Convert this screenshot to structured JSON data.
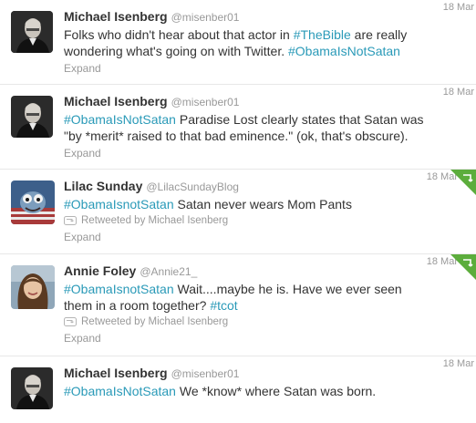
{
  "tweets": [
    {
      "fullname": "Michael Isenberg",
      "username": "@misenber01",
      "time": "18 Mar",
      "text_lines": [
        [
          {
            "t": "Folks who didn't hear about that actor in "
          },
          {
            "t": "#TheBible",
            "tag": true
          },
          {
            "t": " are really"
          }
        ],
        [
          {
            "t": "wondering what's going on with Twitter. "
          },
          {
            "t": "#ObamaIsNotSatan",
            "tag": true
          }
        ]
      ],
      "expand": "Expand"
    },
    {
      "fullname": "Michael Isenberg",
      "username": "@misenber01",
      "time": "18 Mar",
      "text_lines": [
        [
          {
            "t": "#ObamaIsNotSatan",
            "tag": true
          },
          {
            "t": " Paradise Lost clearly states that Satan was"
          }
        ],
        [
          {
            "t": "\"by *merit* raised to that bad eminence.\" (ok, that's obscure)."
          }
        ]
      ],
      "expand": "Expand"
    },
    {
      "fullname": "Lilac Sunday",
      "username": "@LilacSundayBlog",
      "time": "18 Mar",
      "text_lines": [
        [
          {
            "t": "#ObamaIsnotSatan",
            "tag": true
          },
          {
            "t": " Satan never wears Mom Pants"
          }
        ]
      ],
      "retweeted_by": "Retweeted by Michael Isenberg",
      "expand": "Expand"
    },
    {
      "fullname": "Annie Foley",
      "username": "@Annie21_",
      "time": "18 Mar",
      "text_lines": [
        [
          {
            "t": "#ObamaIsnotSatan",
            "tag": true
          },
          {
            "t": " Wait....maybe he is. Have we ever seen"
          }
        ],
        [
          {
            "t": "them in a room together? "
          },
          {
            "t": "#tcot",
            "tag": true
          }
        ]
      ],
      "retweeted_by": "Retweeted by Michael Isenberg",
      "expand": "Expand"
    },
    {
      "fullname": "Michael Isenberg",
      "username": "@misenber01",
      "time": "18 Mar",
      "text_lines": [
        [
          {
            "t": "#ObamaIsNotSatan",
            "tag": true
          },
          {
            "t": " We *know* where Satan was born."
          }
        ]
      ]
    }
  ],
  "colors": {
    "hashtag": "#2a9ab8",
    "retweet_corner": "#5cad3c",
    "muted": "#999999"
  },
  "icons": {
    "retweet": "retweet-icon",
    "corner": "retweet-corner-icon"
  }
}
